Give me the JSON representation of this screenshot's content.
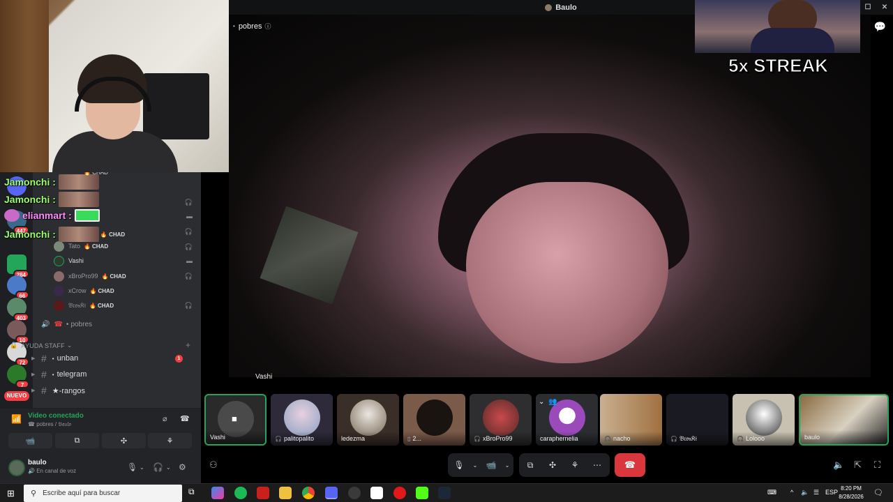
{
  "window": {
    "title": "Baulo",
    "min": "—",
    "max": "☐",
    "close": "✕"
  },
  "webcam_overlay": {
    "label": "streamer webcam"
  },
  "streak": {
    "text": "5x STREAK"
  },
  "stage": {
    "channel_name": "pobres",
    "channel_dot": "•",
    "info": "ⓘ",
    "main_video_name": "Vashi"
  },
  "chat_overlay": [
    {
      "name": "Jamonchi :",
      "color": "#9bff6e"
    },
    {
      "name": "Jamonchi :",
      "color": "#9bff6e"
    },
    {
      "name": "elianmart :",
      "color": "#ff8cff"
    },
    {
      "name": "Jamonchi :",
      "color": "#9bff6e"
    }
  ],
  "voice_users": [
    {
      "name": "Tato",
      "badge": "CHAD",
      "flame": "🔥"
    },
    {
      "name": "Vashi",
      "badge": ""
    },
    {
      "name": "xBroPro99",
      "badge": "CHAD",
      "flame": "🔥"
    },
    {
      "name": "xCrow",
      "badge": "CHAD",
      "flame": "🔥"
    },
    {
      "name": "𝔅𝔯𝔬𝔰𝔎𝔦",
      "badge": "CHAD",
      "flame": "🔥"
    },
    {
      "name": "CHAD",
      "badge": ""
    },
    {
      "name": "CHAD",
      "badge": ""
    }
  ],
  "voice_channel": {
    "name": "pobres",
    "dot": "•"
  },
  "category": {
    "name": "AYUDA STAFF",
    "lock": "🔒",
    "chev": "⌄",
    "add": "+"
  },
  "text_channels": [
    {
      "name": "unban",
      "prefix": "•",
      "unread": "1"
    },
    {
      "name": "telegram",
      "prefix": "•"
    },
    {
      "name": "★-rangos",
      "prefix": ""
    }
  ],
  "guild_badges": [
    "447",
    "284",
    "66",
    "403",
    "10",
    "72",
    "7"
  ],
  "guild_new": "NUEVO",
  "voice_panel": {
    "title": "Video conectado",
    "subtitle": "pobres / 𝔅𝔞𝔲𝔩𝔬",
    "btns": [
      "📹",
      "⧉",
      "✣",
      "⚘"
    ]
  },
  "user_panel": {
    "name": "baulo",
    "status": "En canal de voz"
  },
  "tiles": [
    {
      "name": "Vashi",
      "muted": false,
      "color": "#2a2a2a"
    },
    {
      "name": "palitopalito",
      "muted": true,
      "color": "#2e2a3a"
    },
    {
      "name": "ledezma",
      "muted": false,
      "color": "#3a2e28"
    },
    {
      "name": "2...",
      "muted": false,
      "color": "#7a5a48"
    },
    {
      "name": "xBroPro99",
      "muted": true,
      "color": "#2e2e30"
    },
    {
      "name": "caraphernelia",
      "muted": false,
      "color": "#2b2d31"
    },
    {
      "name": "nacho",
      "muted": true,
      "color": "#b09070"
    },
    {
      "name": "𝔅𝔯𝔬𝔰𝔎𝔦",
      "muted": true,
      "color": "#1a1a22"
    },
    {
      "name": "Lolooo",
      "muted": true,
      "color": "#c8c0b0"
    },
    {
      "name": "baulo",
      "muted": false,
      "color": "#6a5a40"
    }
  ],
  "taskbar": {
    "search_placeholder": "Escribe aquí para buscar",
    "lang": "ESP",
    "time": "8:20 PM",
    "date": "8/28/2026"
  },
  "colors": {
    "accent_green": "#23a55a",
    "hangup_red": "#da373c",
    "badge_red": "#f23f43"
  }
}
